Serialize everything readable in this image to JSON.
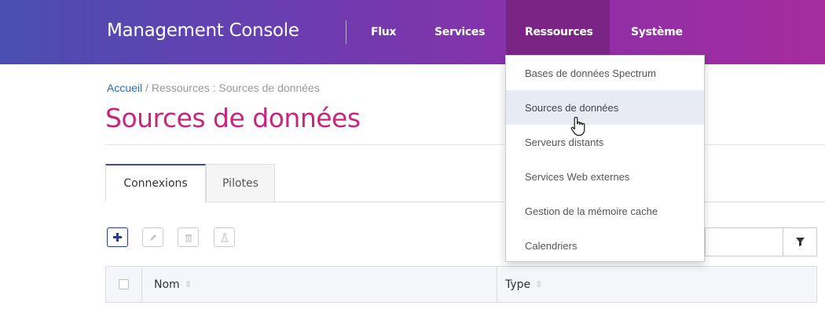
{
  "header": {
    "brand": "Management Console",
    "nav": [
      "Flux",
      "Services",
      "Ressources",
      "Système"
    ],
    "active_nav": "Ressources"
  },
  "breadcrumb": {
    "home": "Accueil",
    "separator": "/",
    "current": "Ressources : Sources de données"
  },
  "page": {
    "title": "Sources de données"
  },
  "tabs": [
    {
      "label": "Connexions",
      "active": true
    },
    {
      "label": "Pilotes",
      "active": false
    }
  ],
  "toolbar": {
    "add_icon": "plus-icon",
    "edit_icon": "pencil-icon",
    "delete_icon": "trash-icon",
    "test_icon": "flask-icon",
    "filter_icon": "filter-icon"
  },
  "search": {
    "value": "",
    "placeholder": ""
  },
  "table": {
    "columns": [
      "Nom",
      "Type"
    ],
    "sort_icon": "⇳"
  },
  "dropdown": {
    "items": [
      "Bases de données Spectrum",
      "Sources de données",
      "Serveurs distants",
      "Services Web externes",
      "Gestion de la mémoire cache",
      "Calendriers"
    ],
    "hovered_index": 1
  },
  "colors": {
    "header_gradient_start": "#4a4fb0",
    "header_gradient_end": "#a52c9e",
    "active_nav": "#7a2486",
    "title": "#c8267c",
    "link": "#2a6ab8",
    "primary_button": "#2b3a92"
  }
}
